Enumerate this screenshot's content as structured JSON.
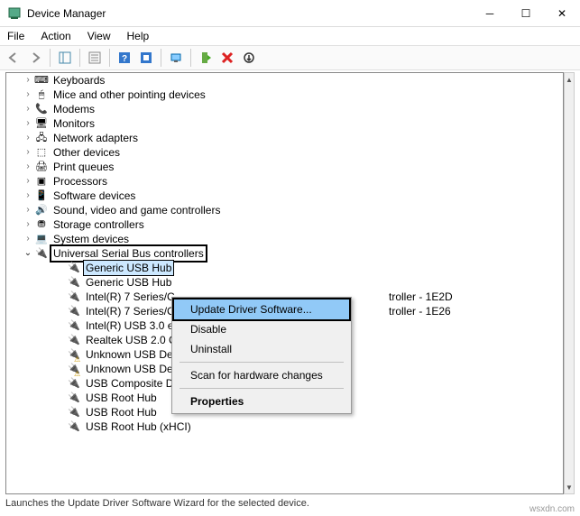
{
  "window": {
    "title": "Device Manager"
  },
  "menubar": [
    "File",
    "Action",
    "View",
    "Help"
  ],
  "tree": {
    "groups": [
      {
        "icon": "⌨",
        "label": "Keyboards"
      },
      {
        "icon": "🖱",
        "label": "Mice and other pointing devices"
      },
      {
        "icon": "📞",
        "label": "Modems"
      },
      {
        "icon": "🖥",
        "label": "Monitors"
      },
      {
        "icon": "🖧",
        "label": "Network adapters"
      },
      {
        "icon": "⬚",
        "label": "Other devices"
      },
      {
        "icon": "🖨",
        "label": "Print queues"
      },
      {
        "icon": "▣",
        "label": "Processors"
      },
      {
        "icon": "📱",
        "label": "Software devices"
      },
      {
        "icon": "🔊",
        "label": "Sound, video and game controllers"
      },
      {
        "icon": "⛃",
        "label": "Storage controllers"
      },
      {
        "icon": "💻",
        "label": "System devices"
      }
    ],
    "usb_group": {
      "icon": "🔌",
      "label": "Universal Serial Bus controllers"
    },
    "usb_children": [
      {
        "label": "Generic USB Hub",
        "selected": true
      },
      {
        "label": "Generic USB Hub"
      },
      {
        "label": "Intel(R) 7 Series/C216 Chipset Family USB Enhanced Host Controller - 1E2D",
        "truncated": "Intel(R) 7 Series/C"
      },
      {
        "label": "Intel(R) 7 Series/C216 Chipset Family USB Enhanced Host Controller - 1E26",
        "truncated": "Intel(R) 7 Series/C"
      },
      {
        "label": "Intel(R) USB 3.0 eXtensible Host Controller",
        "truncated": "Intel(R) USB 3.0 eX"
      },
      {
        "label": "Realtek USB 2.0 Card Reader",
        "truncated": "Realtek USB 2.0 C"
      },
      {
        "label": "Unknown USB Device",
        "truncated": "Unknown USB De",
        "warn": true
      },
      {
        "label": "Unknown USB Device",
        "truncated": "Unknown USB De",
        "warn": true
      },
      {
        "label": "USB Composite Device"
      },
      {
        "label": "USB Root Hub"
      },
      {
        "label": "USB Root Hub"
      },
      {
        "label": "USB Root Hub (xHCI)"
      }
    ],
    "trailing_rows": [
      {
        "right": "troller - 1E2D"
      },
      {
        "right": "troller - 1E26"
      }
    ]
  },
  "context_menu": {
    "items": [
      {
        "label": "Update Driver Software...",
        "highlight": true
      },
      {
        "label": "Disable"
      },
      {
        "label": "Uninstall"
      },
      {
        "sep": true
      },
      {
        "label": "Scan for hardware changes"
      },
      {
        "sep": true
      },
      {
        "label": "Properties",
        "bold": true
      }
    ]
  },
  "status": "Launches the Update Driver Software Wizard for the selected device.",
  "watermark": "wsxdn.com"
}
